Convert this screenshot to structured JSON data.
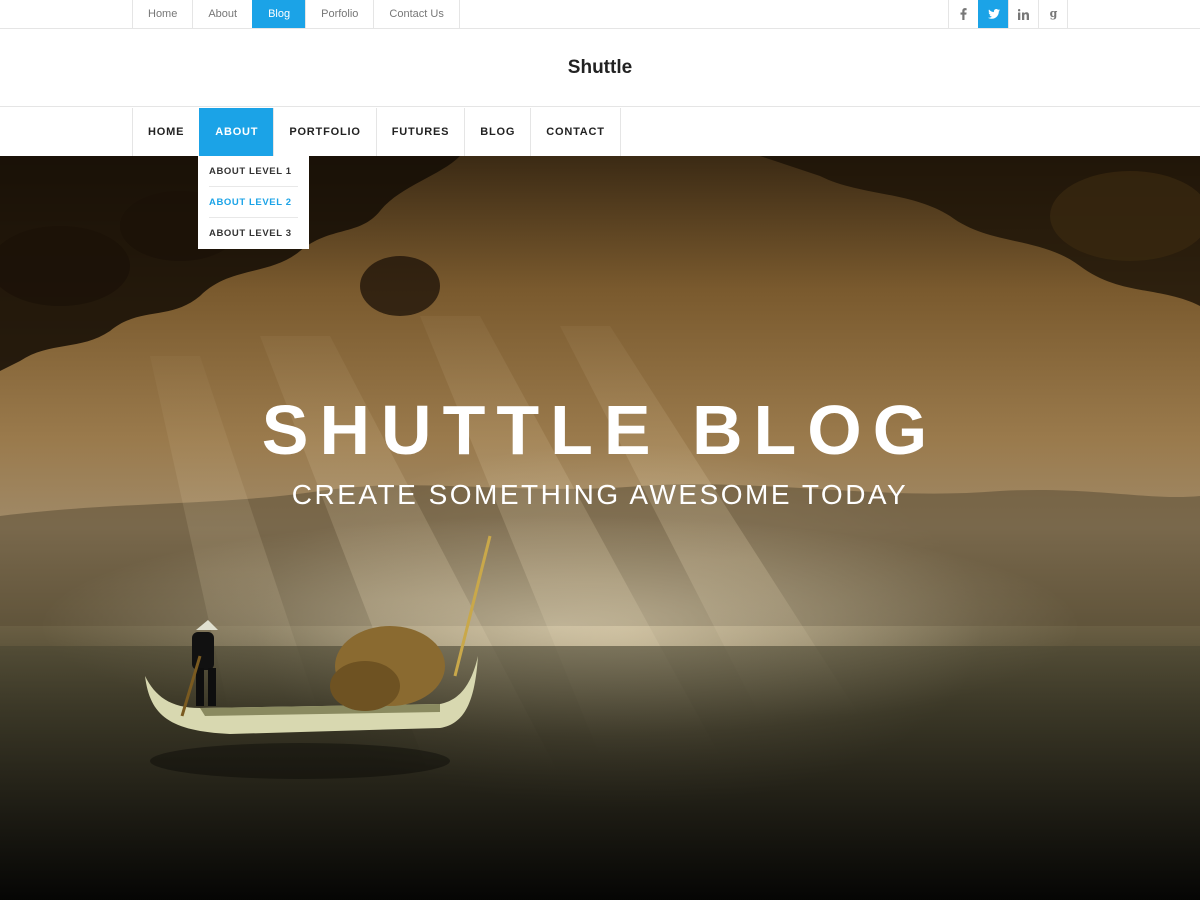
{
  "topnav": {
    "items": [
      {
        "label": "Home"
      },
      {
        "label": "About"
      },
      {
        "label": "Blog"
      },
      {
        "label": "Porfolio"
      },
      {
        "label": "Contact Us"
      }
    ],
    "active_index": 2
  },
  "social": {
    "icons": [
      "facebook-icon",
      "twitter-icon",
      "linkedin-icon",
      "google-icon"
    ],
    "active_icon": "twitter-icon"
  },
  "header": {
    "site_title": "Shuttle"
  },
  "mainnav": {
    "items": [
      {
        "label": "HOME"
      },
      {
        "label": "ABOUT"
      },
      {
        "label": "PORTFOLIO"
      },
      {
        "label": "FUTURES"
      },
      {
        "label": "BLOG"
      },
      {
        "label": "CONTACT"
      }
    ],
    "active_index": 1,
    "dropdown": [
      {
        "label": "ABOUT LEVEL 1"
      },
      {
        "label": "ABOUT LEVEL 2"
      },
      {
        "label": "ABOUT LEVEL 3"
      }
    ],
    "dropdown_active_index": 1
  },
  "hero": {
    "title": "SHUTTLE BLOG",
    "subtitle": "CREATE SOMETHING AWESOME TODAY"
  },
  "colors": {
    "accent": "#1ba3e7",
    "text_dark": "#222222",
    "text_muted": "#777777"
  }
}
